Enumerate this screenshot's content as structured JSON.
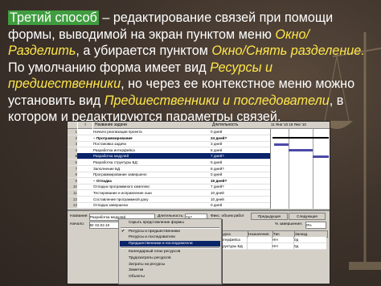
{
  "slide": {
    "heading_highlight": "Третий способ",
    "line1_rest": " – редактирование связей при помощи",
    "line2_start": "формы, выводимой на экран пунктом меню ",
    "menu_split": "Окно/Разделить",
    "line2_end": ",",
    "line3_start": "а убирается пунктом ",
    "menu_unsplit": "Окно/Снять разделение.",
    "para2_start": "По умолчанию форма имеет вид ",
    "view_default": "Ресурсы и предшественники",
    "para2_mid": ", но через ее контекстное меню можно установить вид ",
    "view_alt": "Предшественники и последователи",
    "para2_end": ", в котором и редактируются параметры связей."
  },
  "screenshot": {
    "table": {
      "col_info": "i",
      "col_name": "Название задачи",
      "col_duration": "Длительность",
      "rows": [
        {
          "n": "1",
          "name": "Начало реализации проекта",
          "dur": "0 дней",
          "bold": false
        },
        {
          "n": "2",
          "name": "– Программирование",
          "dur": "24 дней?",
          "bold": true
        },
        {
          "n": "3",
          "name": "Постановка задачи",
          "dur": "3 дней",
          "bold": false
        },
        {
          "n": "4",
          "name": "Разработка интерфейса",
          "dur": "5 дней",
          "bold": false
        },
        {
          "n": "5",
          "name": "Разработка модулей",
          "dur": "7 дней?",
          "bold": false,
          "selected": true
        },
        {
          "n": "6",
          "name": "Разработка структуры БД",
          "dur": "6 дней",
          "bold": false
        },
        {
          "n": "7",
          "name": "Заполнение БД",
          "dur": "8 дней?",
          "bold": false
        },
        {
          "n": "8",
          "name": "Программирование завершено",
          "dur": "0 дней",
          "bold": false
        },
        {
          "n": "9",
          "name": "– Отладка",
          "dur": "15 дней?",
          "bold": true
        },
        {
          "n": "10",
          "name": "Отладка программного комплекс",
          "dur": "7 дней?",
          "bold": false
        },
        {
          "n": "11",
          "name": "Тестирование и исправление оши",
          "dur": "10 дней",
          "bold": false
        },
        {
          "n": "12",
          "name": "Составление программной доку",
          "dur": "10 дней",
          "bold": false
        },
        {
          "n": "13",
          "name": "Отладка завершена",
          "dur": "0 дней",
          "bold": false
        }
      ]
    },
    "chart": {
      "header": "11 Янв '10    18 Янв '10"
    },
    "form": {
      "name_label": "Название:",
      "name_value": "Разработка модулей",
      "duration_label": "Длительность:",
      "duration_value": "7д?",
      "effort_label": "Фикс. объем работ",
      "prev_button": "Предыдущая",
      "next_button": "Следующая",
      "start_label": "Начало:",
      "start_value": "Вт 02.02.10",
      "finish_label": "Око:",
      "finish_value": "10.02.10",
      "pct_label": "% завершения:",
      "pct_value": "0%",
      "grid_headers": [
        "Ид.",
        "Название ресурса",
        "Назначения",
        "Тип",
        "Запазд."
      ],
      "grid_rows": [
        [
          "3",
          "Разработка интерфейса",
          "",
          "НН",
          "0д"
        ],
        [
          "6",
          "Разработка структуры БД",
          "",
          "НН",
          "0д"
        ]
      ]
    },
    "context_menu": {
      "items": [
        {
          "label": "Скрыть представление формы",
          "checked": false,
          "active": false
        },
        {
          "label": "Ресурсы и предшественники",
          "checked": true,
          "active": false
        },
        {
          "label": "Ресурсы и последователи",
          "checked": false,
          "active": false
        },
        {
          "label": "Предшественники и последователи",
          "checked": false,
          "active": true
        },
        {
          "label": "Календарный план ресурсов",
          "checked": false,
          "active": false
        },
        {
          "label": "Трудозатраты ресурсов",
          "checked": false,
          "active": false
        },
        {
          "label": "Затраты на ресурсы",
          "checked": false,
          "active": false
        },
        {
          "label": "Заметки",
          "checked": false,
          "active": false
        },
        {
          "label": "Объекты",
          "checked": false,
          "active": false
        }
      ]
    }
  }
}
